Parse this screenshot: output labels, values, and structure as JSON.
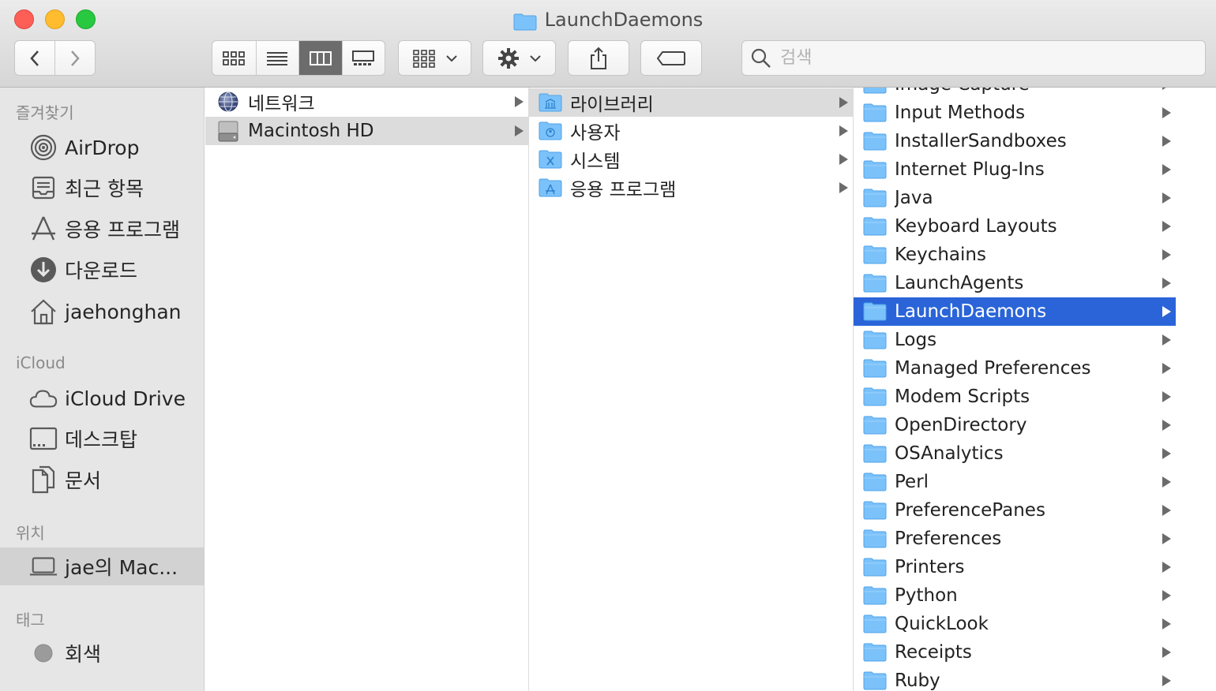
{
  "window": {
    "title": "LaunchDaemons"
  },
  "search": {
    "placeholder": "검색"
  },
  "sidebar": {
    "sections": [
      {
        "heading": "즐겨찾기",
        "items": [
          {
            "label": "AirDrop",
            "icon": "airdrop-icon"
          },
          {
            "label": "최근 항목",
            "icon": "recents-icon"
          },
          {
            "label": "응용 프로그램",
            "icon": "applications-icon"
          },
          {
            "label": "다운로드",
            "icon": "download-icon"
          },
          {
            "label": "jaehonghan",
            "icon": "home-icon"
          }
        ]
      },
      {
        "heading": "iCloud",
        "items": [
          {
            "label": "iCloud Drive",
            "icon": "cloud-icon"
          },
          {
            "label": "데스크탑",
            "icon": "desktop-icon"
          },
          {
            "label": "문서",
            "icon": "document-icon"
          }
        ]
      },
      {
        "heading": "위치",
        "items": [
          {
            "label": "jae의 Mac...",
            "icon": "laptop-icon",
            "selected": true
          }
        ]
      },
      {
        "heading": "태그",
        "items": [
          {
            "label": "회색",
            "icon": "gray-tag-icon",
            "color": "#9b9b9b"
          }
        ]
      }
    ]
  },
  "columns": {
    "col1": [
      {
        "label": "네트워크",
        "icon": "network-icon"
      },
      {
        "label": "Macintosh HD",
        "icon": "hard-drive-icon",
        "selected": true
      }
    ],
    "col2": [
      {
        "label": "라이브러리",
        "icon": "library-folder-icon",
        "selected": true
      },
      {
        "label": "사용자",
        "icon": "users-folder-icon"
      },
      {
        "label": "시스템",
        "icon": "system-folder-icon"
      },
      {
        "label": "응용 프로그램",
        "icon": "applications-folder-icon"
      }
    ],
    "col3": [
      {
        "label": "Image Capture"
      },
      {
        "label": "Input Methods"
      },
      {
        "label": "InstallerSandboxes"
      },
      {
        "label": "Internet Plug-Ins"
      },
      {
        "label": "Java"
      },
      {
        "label": "Keyboard Layouts"
      },
      {
        "label": "Keychains"
      },
      {
        "label": "LaunchAgents"
      },
      {
        "label": "LaunchDaemons",
        "selected": true
      },
      {
        "label": "Logs"
      },
      {
        "label": "Managed Preferences"
      },
      {
        "label": "Modem Scripts"
      },
      {
        "label": "OpenDirectory"
      },
      {
        "label": "OSAnalytics"
      },
      {
        "label": "Perl"
      },
      {
        "label": "PreferencePanes"
      },
      {
        "label": "Preferences"
      },
      {
        "label": "Printers"
      },
      {
        "label": "Python"
      },
      {
        "label": "QuickLook"
      },
      {
        "label": "Receipts"
      },
      {
        "label": "Ruby"
      }
    ]
  },
  "colors": {
    "selection_blue": "#2a64d8",
    "folder_blue": "#66b6f7"
  }
}
